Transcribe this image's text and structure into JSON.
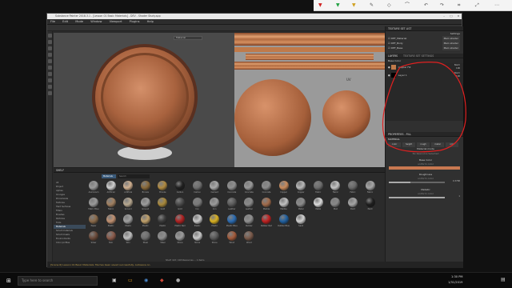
{
  "ink_toolbar": {
    "icons": [
      "pen-red",
      "pen-green",
      "pen-yellow",
      "highlighter",
      "eraser",
      "lasso",
      "undo",
      "redo",
      "crop",
      "fullscreen",
      "more"
    ]
  },
  "window": {
    "title": "Substance Painter 2018.3.1 - [Lesson 01 Basic Materials] - DEV - Shader Study.spp",
    "menu": [
      "File",
      "Edit",
      "Mode",
      "Window",
      "Viewport",
      "Plugins",
      "Help"
    ],
    "viewport_dropdown": "Material"
  },
  "texture_set_list": {
    "header": "TEXTURE SET LIST",
    "settings_label": "Settings",
    "items": [
      {
        "name": "DEF_Material",
        "shader": "Main shader"
      },
      {
        "name": "DEF_Body",
        "shader": "Main shader"
      },
      {
        "name": "DEF_Base",
        "shader": "Main shader"
      }
    ]
  },
  "layers": {
    "tabs": [
      "LAYERS",
      "TEXTURE SET SETTINGS"
    ],
    "blend_mode": "Base Color",
    "items": [
      {
        "name": "Copper Fill",
        "blend": "Norm",
        "opacity": "100"
      },
      {
        "name": "Layer 1",
        "blend": "Norm",
        "opacity": "100"
      }
    ]
  },
  "properties": {
    "header": "PROPERTIES - FILL",
    "section": "MATERIAL",
    "channels": [
      "color",
      "height",
      "rough",
      "metal",
      "nrm"
    ],
    "material_mode": "Material mode",
    "material_mode_value": "No Resource Selected",
    "base_color_label": "Base Color",
    "base_color_sub": "uniform color",
    "base_color_hex": "#c87850",
    "roughness_label": "Roughness",
    "roughness_sub": "uniform color",
    "roughness_value": "0.3788",
    "metallic_label": "Metallic",
    "metallic_sub": "uniform color",
    "metallic_value": "1"
  },
  "shelf": {
    "title": "SHELF",
    "search_placeholder": "Search",
    "filter_tag": "Materials",
    "categories": [
      "All",
      "Project",
      "Alphas",
      "Grunges",
      "Procedurals",
      "Textures",
      "Hard Surfaces",
      "Filters",
      "Brushes",
      "Particles",
      "Tools",
      "Materials",
      "Smart materials",
      "Smart masks",
      "Environments",
      "Color profiles"
    ],
    "selected_category": "Materials",
    "materials": [
      {
        "name": "Aluminium",
        "c": "#9a9a9a"
      },
      {
        "name": "Artificial",
        "c": "#cfcfcf"
      },
      {
        "name": "Artificial",
        "c": "#d0b090"
      },
      {
        "name": "Bronze",
        "c": "#8a6a3a"
      },
      {
        "name": "Bronze",
        "c": "#b08a40"
      },
      {
        "name": "Carbon",
        "c": "#202020"
      },
      {
        "name": "Carbon",
        "c": "#6f6f6f"
      },
      {
        "name": "Cement",
        "c": "#a9a9a9"
      },
      {
        "name": "Concrete",
        "c": "#8f8f8f"
      },
      {
        "name": "Concrete",
        "c": "#999"
      },
      {
        "name": "Concrete",
        "c": "#8c8c8c"
      },
      {
        "name": "Copper",
        "c": "#c98a5a"
      },
      {
        "name": "Copper",
        "c": "#b8b8b8"
      },
      {
        "name": "Fabric",
        "c": "#6d6d6d"
      },
      {
        "name": "Fabric",
        "c": "#c4c4c4"
      },
      {
        "name": "Fabric",
        "c": "#6a6a6a"
      },
      {
        "name": "Fabric",
        "c": "#a5a5a5"
      },
      {
        "name": "Fabric Blue",
        "c": "#9a9a9a"
      },
      {
        "name": "Fabric",
        "c": "#a18060"
      },
      {
        "name": "Ground",
        "c": "#b8a890"
      },
      {
        "name": "Ground",
        "c": "#9c9c9c"
      },
      {
        "name": "Gold",
        "c": "#a8883a"
      },
      {
        "name": "Gold",
        "c": "#4a4a4a"
      },
      {
        "name": "Iron",
        "c": "#7a7a7a"
      },
      {
        "name": "Iron",
        "c": "#9a9a9a"
      },
      {
        "name": "Leather",
        "c": "#5a5a5a"
      },
      {
        "name": "Leather",
        "c": "#8a8a8a"
      },
      {
        "name": "Marble",
        "c": "#a06a4a"
      },
      {
        "name": "Marble",
        "c": "#c0c0c0"
      },
      {
        "name": "Metal",
        "c": "#8b8b8b"
      },
      {
        "name": "Metal",
        "c": "#dcdcdc"
      },
      {
        "name": "Mud",
        "c": "#888"
      },
      {
        "name": "Paint",
        "c": "#a5a5a5"
      },
      {
        "name": "Paint",
        "c": "#1e1e1e"
      },
      {
        "name": "Paper",
        "c": "#8a6a4a"
      },
      {
        "name": "Plastic",
        "c": "#c09070"
      },
      {
        "name": "Plastic",
        "c": "#a0a0a0"
      },
      {
        "name": "Plastic",
        "c": "#c0a06a"
      },
      {
        "name": "Plastic",
        "c": "#3a3a3a"
      },
      {
        "name": "Plastic Red",
        "c": "#b02020"
      },
      {
        "name": "Plastic",
        "c": "#c8c8c8"
      },
      {
        "name": "Plastic",
        "c": "#d8b020"
      },
      {
        "name": "Plastic Blue",
        "c": "#2a6ab0"
      },
      {
        "name": "Rubber",
        "c": "#909090"
      },
      {
        "name": "Rubber Red",
        "c": "#c02020"
      },
      {
        "name": "Rubber Blue",
        "c": "#2060a0"
      },
      {
        "name": "Sand",
        "c": "#d0d0d0"
      },
      {
        "name": "Silver",
        "c": "#6a4a3a"
      },
      {
        "name": "Skin",
        "c": "#8a5a4a"
      },
      {
        "name": "Skin",
        "c": "#bfbfbf"
      },
      {
        "name": "Steel",
        "c": "#6f6f6f"
      },
      {
        "name": "Steel",
        "c": "#8d8d8d"
      },
      {
        "name": "Stone",
        "c": "#9a9a9a"
      },
      {
        "name": "Stone",
        "c": "#c9c9c9"
      },
      {
        "name": "Stone",
        "c": "#5a5a5a"
      },
      {
        "name": "Wood",
        "c": "#a25a3a"
      },
      {
        "name": "Wood",
        "c": "#7a5a4a"
      },
      {
        "name": "Wood Beech",
        "c": "#4a3a3a"
      }
    ],
    "footer": "Shelf: 143 / 163 Resources ... 1 items"
  },
  "status": "[Scene 6] Lesson 01 Basic Materials: file has been saved successfully. Autosave on.",
  "taskbar": {
    "search": "Type here to search",
    "time": "1:30 PM",
    "date": "1/31/2019"
  },
  "colors": {
    "copper": "#c07a4a",
    "accent": "#ff8a3a",
    "ink": "#e02020"
  }
}
